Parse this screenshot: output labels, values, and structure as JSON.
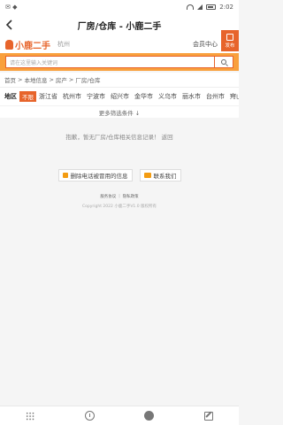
{
  "status": {
    "time": "2:02"
  },
  "titlebar": {
    "title": "厂房/仓库 - 小鹿二手"
  },
  "header": {
    "logo": "小鹿二手",
    "city": "杭州",
    "member": "会员中心",
    "publish": "发布"
  },
  "search": {
    "placeholder": "请在这里输入关键词"
  },
  "breadcrumb": [
    "首页",
    ">",
    "本地信息",
    ">",
    "房产",
    ">",
    "厂房/仓库"
  ],
  "region": {
    "label": "地区",
    "selected": "不限",
    "items": [
      "浙江省",
      "杭州市",
      "宁波市",
      "绍兴市",
      "金华市",
      "义乌市",
      "丽水市",
      "台州市",
      "舟山市"
    ]
  },
  "more": "更多筛选条件 ↓",
  "empty": "抱歉，暂无厂房/仓库相关信息记录！ 返回",
  "actions": {
    "delete": "删除电话被冒用的信息",
    "contact": "联系我们"
  },
  "footer": {
    "links": "服务协议 ｜ 隐私政策",
    "copyright": "Copyright 2022 小鹿二手V1.0 版权所有"
  }
}
